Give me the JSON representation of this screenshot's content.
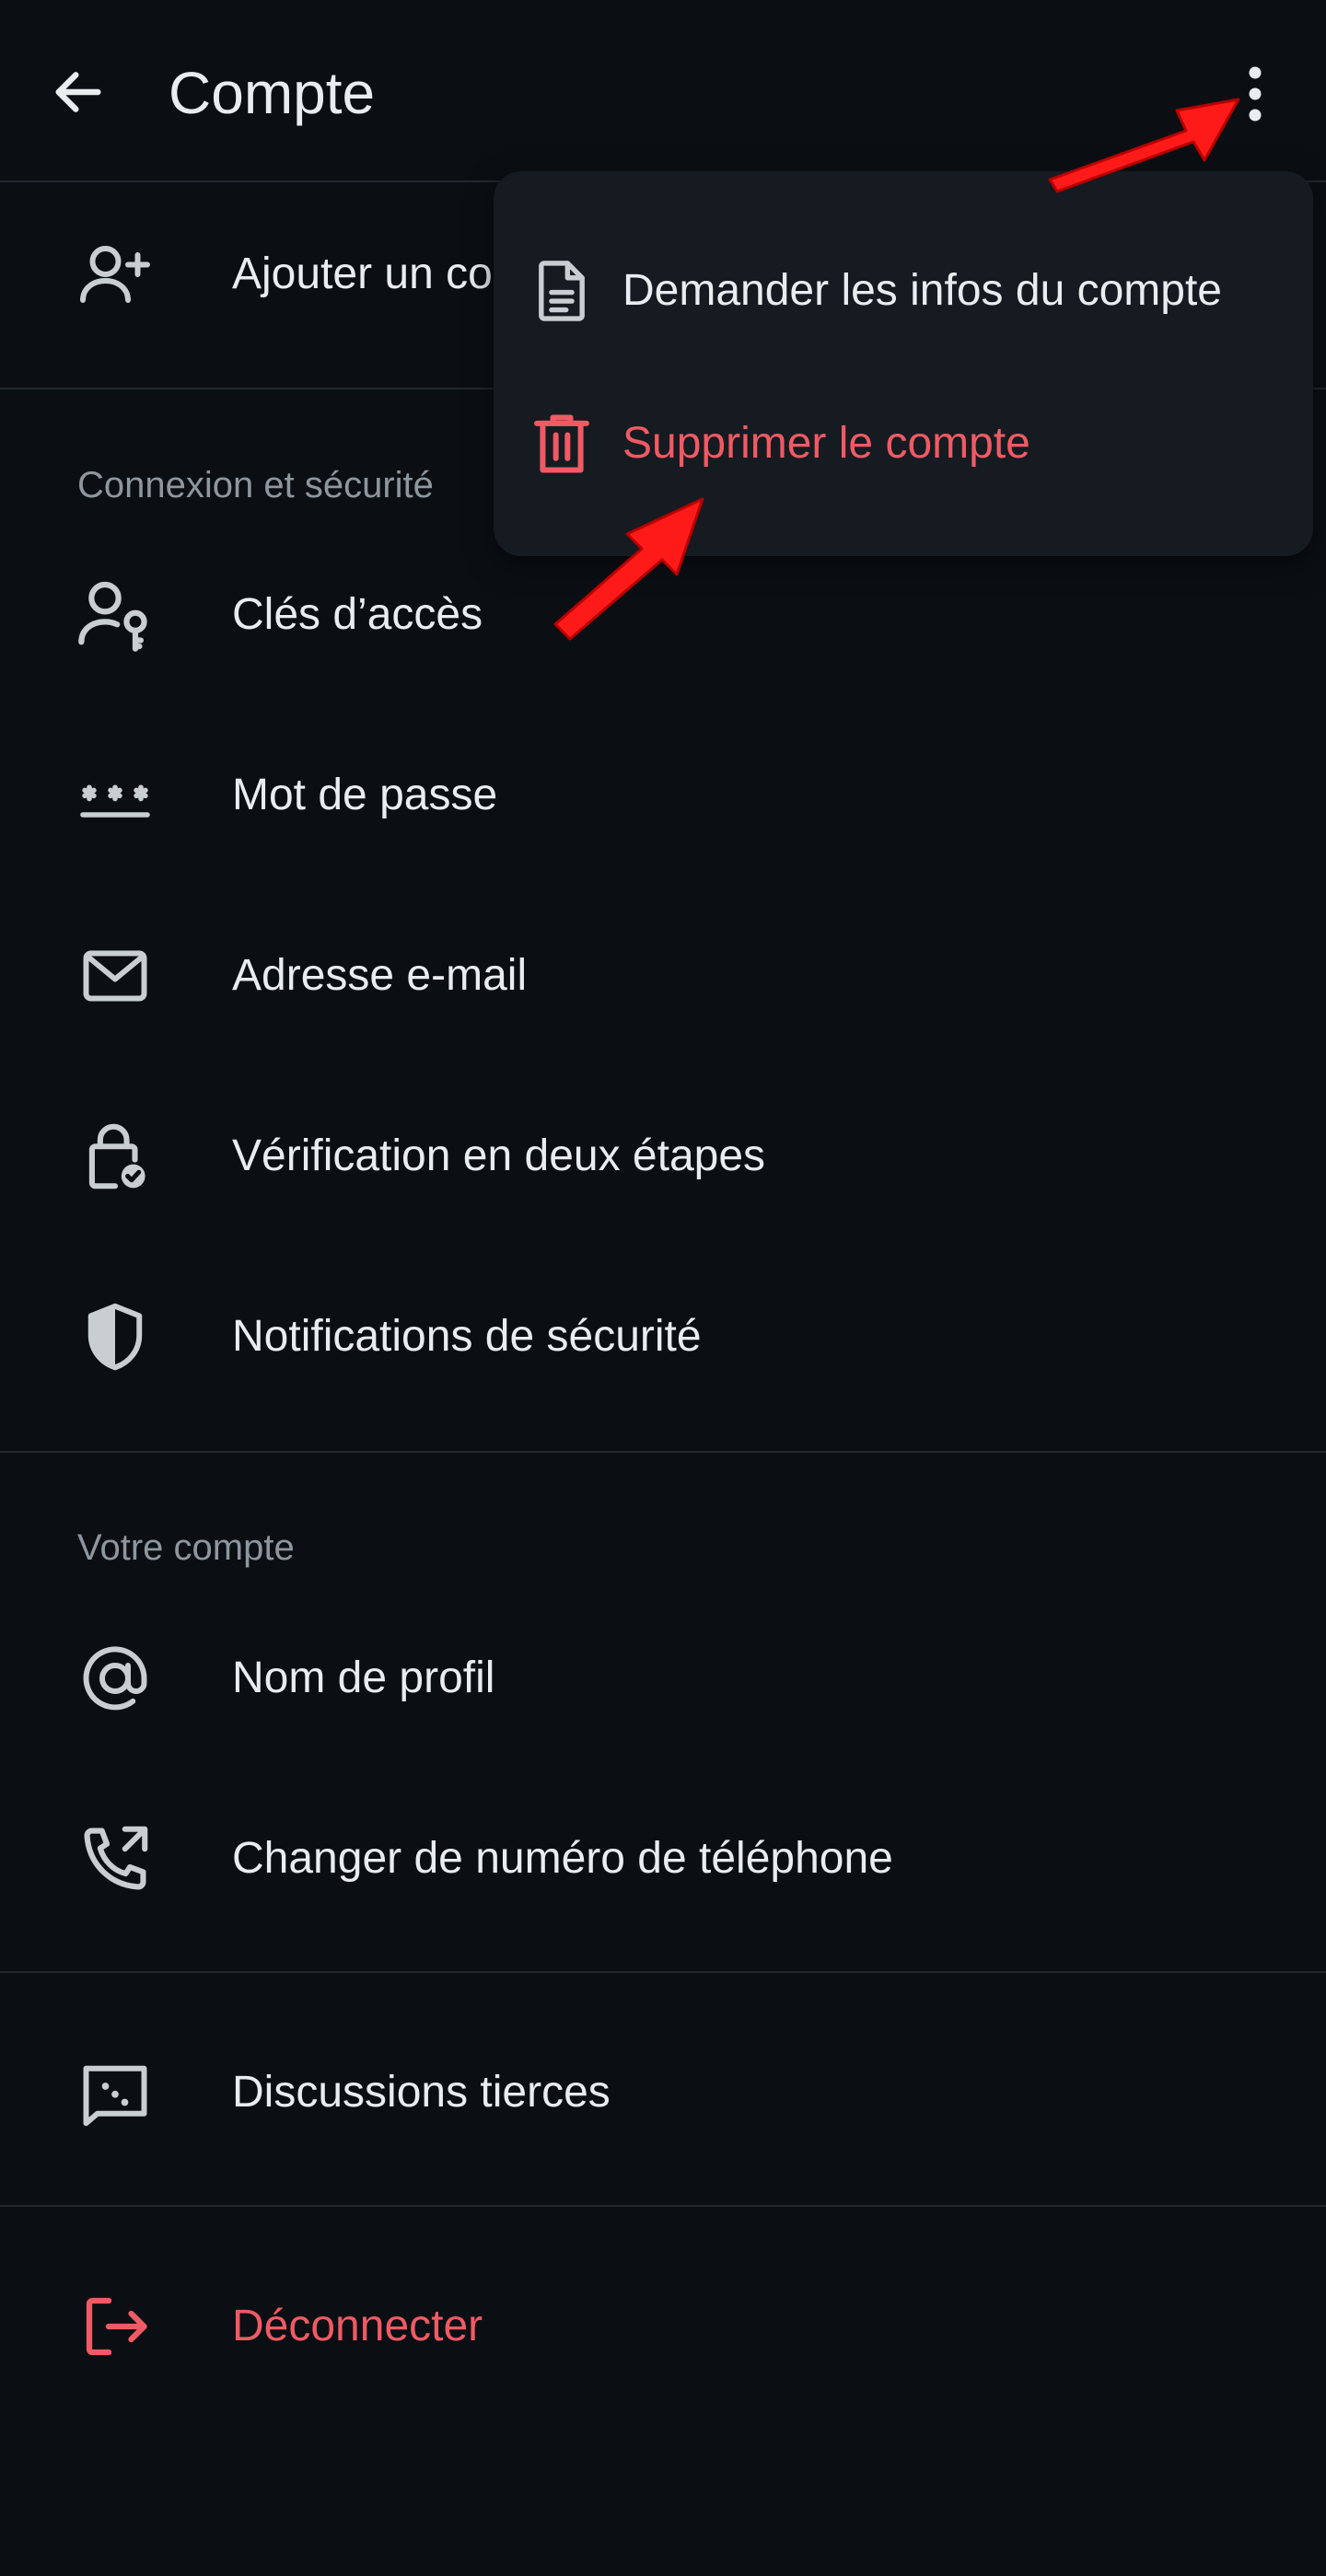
{
  "header": {
    "title": "Compte",
    "back_icon": "arrow-left-icon",
    "more_icon": "more-vertical-icon"
  },
  "top_item": {
    "label": "Ajouter un co",
    "icon": "person-add-icon"
  },
  "sections": [
    {
      "header": "Connexion et sécurité",
      "items": [
        {
          "label": "Clés d’accès",
          "icon": "passkey-icon"
        },
        {
          "label": "Mot de passe",
          "icon": "password-icon"
        },
        {
          "label": "Adresse e-mail",
          "icon": "mail-icon"
        },
        {
          "label": "Vérification en deux étapes",
          "icon": "lock-check-icon"
        },
        {
          "label": "Notifications de sécurité",
          "icon": "shield-icon"
        }
      ]
    },
    {
      "header": "Votre compte",
      "items": [
        {
          "label": "Nom de profil",
          "icon": "at-icon"
        },
        {
          "label": "Changer de numéro de téléphone",
          "icon": "phone-change-icon"
        }
      ]
    }
  ],
  "third_party": {
    "label": "Discussions tierces",
    "icon": "chat-dice-icon"
  },
  "logout": {
    "label": "Déconnecter",
    "icon": "logout-icon"
  },
  "menu": {
    "items": [
      {
        "label": "Demander les infos du compte",
        "icon": "document-icon"
      },
      {
        "label": "Supprimer le compte",
        "icon": "trash-icon"
      }
    ]
  },
  "colors": {
    "background": "#0b0f14",
    "menu_background": "#161b21",
    "text": "#e9edf0",
    "section_text": "#8e969e",
    "danger": "#f05a64",
    "annotation_arrow": "#ff1a1a"
  }
}
